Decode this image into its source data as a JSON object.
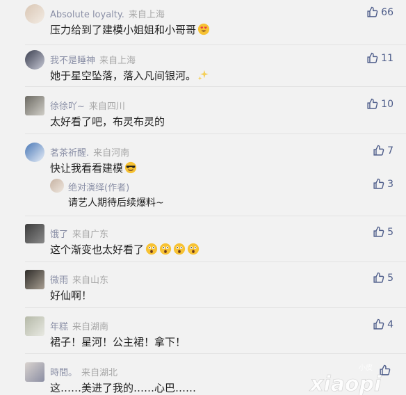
{
  "comments": [
    {
      "user": "Absolute loyalty.",
      "location": "来自上海",
      "text": "压力给到了建模小姐姐和小哥哥",
      "likes": "66",
      "emoji": "heart-eyes-emoji"
    },
    {
      "user": "我不是睡神",
      "location": "来自上海",
      "text": "她于星空坠落，落入凡间银河。",
      "likes": "11",
      "emoji": "sparkles-emoji"
    },
    {
      "user": "徐徐吖~",
      "location": "来自四川",
      "text": "太好看了吧，布灵布灵的",
      "likes": "10"
    },
    {
      "user": "茗茶祈醒.",
      "location": "来自河南",
      "text": "快让我看看建模",
      "likes": "7",
      "emoji": "sunglasses-emoji",
      "reply": {
        "user": "绝对演绎(作者)",
        "text": "请艺人期待后续爆料~",
        "likes": "3"
      }
    },
    {
      "user": "饿了",
      "location": "来自广东",
      "text": "这个渐变也太好看了",
      "likes": "5",
      "emoji": "astonished-emoji-x4"
    },
    {
      "user": "微雨",
      "location": "来自山东",
      "text": "好仙啊！",
      "likes": "5"
    },
    {
      "user": "年糕",
      "location": "来自湖南",
      "text": "裙子！星河！公主裙！拿下！",
      "likes": "4"
    },
    {
      "user": "時間。",
      "location": "来自湖北",
      "text": "这……美进了我的……心巴……",
      "likes": ""
    }
  ],
  "colors": {
    "background": "#f2f2f2",
    "username": "#8a8fa6",
    "like": "#4e5d8a",
    "location": "#a6a6a6"
  },
  "watermark": {
    "text": "xiaopi",
    "small_text": "小皮"
  }
}
